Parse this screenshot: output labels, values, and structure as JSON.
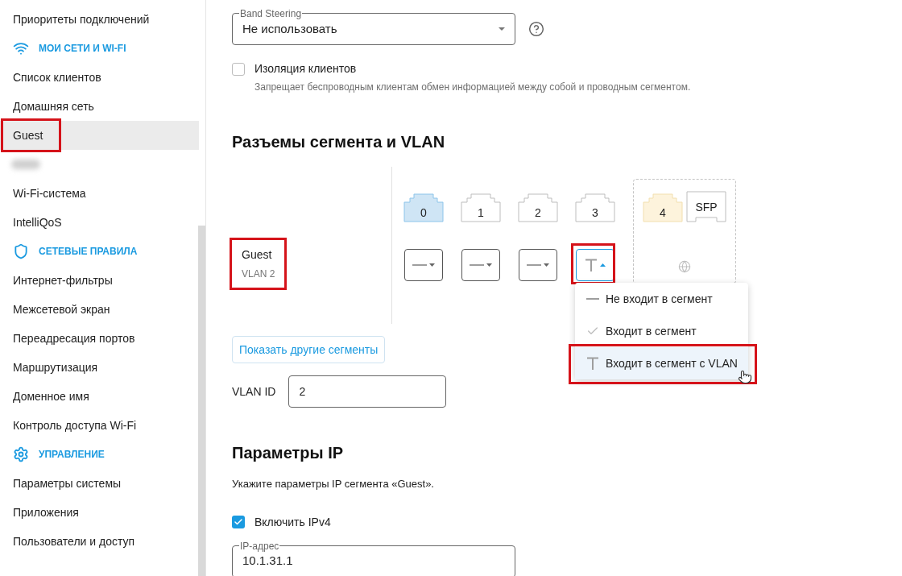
{
  "sidebar": {
    "items": [
      {
        "kind": "item",
        "label": "Приоритеты подключений",
        "selected": false,
        "annotated": false
      },
      {
        "kind": "section",
        "label": "МОИ СЕТИ И WI-FI"
      },
      {
        "kind": "item",
        "label": "Список клиентов",
        "selected": false,
        "annotated": false
      },
      {
        "kind": "item",
        "label": "Домашняя сеть",
        "selected": false,
        "annotated": false
      },
      {
        "kind": "item",
        "label": "Guest",
        "selected": true,
        "annotated": true
      },
      {
        "kind": "blurred"
      },
      {
        "kind": "item",
        "label": "Wi-Fi-система",
        "selected": false,
        "annotated": false
      },
      {
        "kind": "item",
        "label": "IntelliQoS",
        "selected": false,
        "annotated": false
      },
      {
        "kind": "section",
        "label": "СЕТЕВЫЕ ПРАВИЛА"
      },
      {
        "kind": "item",
        "label": "Интернет-фильтры",
        "selected": false,
        "annotated": false
      },
      {
        "kind": "item",
        "label": "Межсетевой экран",
        "selected": false,
        "annotated": false
      },
      {
        "kind": "item",
        "label": "Переадресация портов",
        "selected": false,
        "annotated": false
      },
      {
        "kind": "item",
        "label": "Маршрутизация",
        "selected": false,
        "annotated": false
      },
      {
        "kind": "item",
        "label": "Доменное имя",
        "selected": false,
        "annotated": false
      },
      {
        "kind": "item",
        "label": "Контроль доступа Wi-Fi",
        "selected": false,
        "annotated": false
      },
      {
        "kind": "section",
        "label": "УПРАВЛЕНИЕ"
      },
      {
        "kind": "item",
        "label": "Параметры системы",
        "selected": false,
        "annotated": false
      },
      {
        "kind": "item",
        "label": "Приложения",
        "selected": false,
        "annotated": false
      },
      {
        "kind": "item",
        "label": "Пользователи и доступ",
        "selected": false,
        "annotated": false
      }
    ]
  },
  "band_steering": {
    "label": "Band Steering",
    "value": "Не использовать"
  },
  "client_isolation": {
    "label": "Изоляция клиентов",
    "checked": false,
    "description": "Запрещает беспроводным клиентам обмен информацией между собой и проводным сегментом."
  },
  "segment_ports": {
    "title": "Разъемы сегмента и VLAN",
    "segment": {
      "name": "Guest",
      "vlan": "VLAN 2",
      "annotated": true
    },
    "ports": [
      {
        "label": "0",
        "color": "#cfe5f5",
        "kind": "none",
        "open": false,
        "annotated": false
      },
      {
        "label": "1",
        "kind": "none",
        "open": false,
        "annotated": false
      },
      {
        "label": "2",
        "kind": "none",
        "open": false,
        "annotated": false
      },
      {
        "label": "3",
        "kind": "vlan",
        "open": true,
        "annotated": true
      }
    ],
    "wan_ports": [
      {
        "label": "4",
        "color": "#fdf3dc"
      },
      {
        "label": "SFP"
      }
    ],
    "menu": [
      {
        "kind": "none",
        "label": "Не входит в сегмент",
        "selected": false,
        "annotated": false
      },
      {
        "kind": "member",
        "label": "Входит в сегмент",
        "selected": false,
        "annotated": false
      },
      {
        "kind": "vlan",
        "label": "Входит в сегмент с VLAN",
        "selected": true,
        "annotated": true
      }
    ],
    "show_more": "Показать другие сегменты"
  },
  "vlan_id": {
    "label": "VLAN ID",
    "value": "2"
  },
  "ip": {
    "title": "Параметры IP",
    "description": "Укажите параметры IP сегмента «Guest».",
    "ipv4": {
      "label": "Включить IPv4",
      "checked": true
    },
    "address": {
      "label": "IP-адрес",
      "value": "10.1.31.1"
    }
  }
}
